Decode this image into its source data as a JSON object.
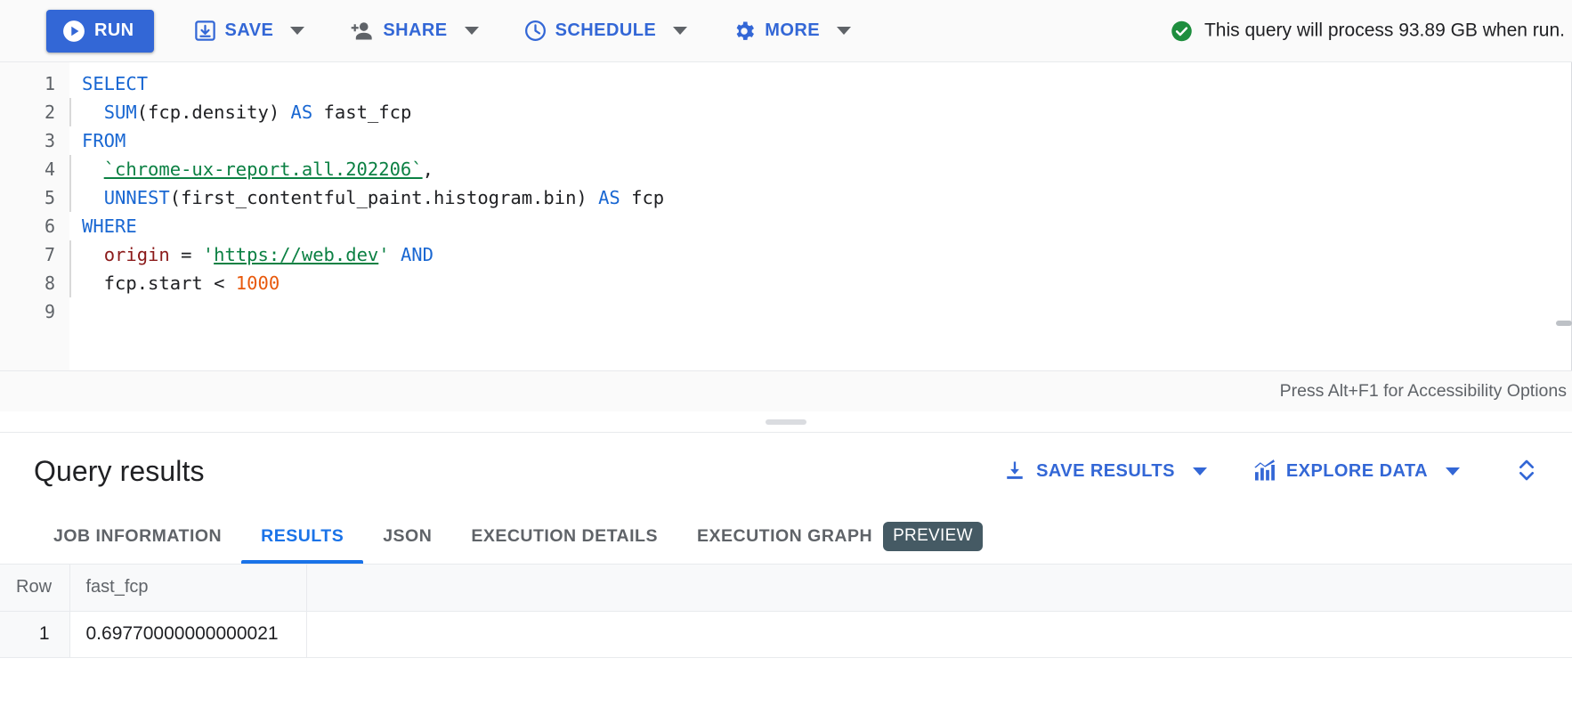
{
  "toolbar": {
    "run_label": "RUN",
    "save_label": "SAVE",
    "share_label": "SHARE",
    "schedule_label": "SCHEDULE",
    "more_label": "MORE",
    "cost_message": "This query will process 93.89 GB when run.",
    "icons": {
      "run": "play-circle-icon",
      "save": "save-download-icon",
      "share": "person-add-icon",
      "schedule": "clock-icon",
      "more": "gear-icon",
      "validation": "check-circle-icon"
    },
    "colors": {
      "accent_blue": "#3367d6",
      "success_green": "#1e8e3e",
      "caret_gray": "#5f6368"
    }
  },
  "editor": {
    "line_numbers": [
      "1",
      "2",
      "3",
      "4",
      "5",
      "6",
      "7",
      "8",
      "9"
    ],
    "lines": [
      {
        "n": "1",
        "tokens": [
          {
            "t": "SELECT",
            "c": "kw"
          }
        ]
      },
      {
        "n": "2",
        "tokens": [
          {
            "t": "  ",
            "c": "plain"
          },
          {
            "t": "SUM",
            "c": "fn"
          },
          {
            "t": "(fcp.density) ",
            "c": "plain"
          },
          {
            "t": "AS",
            "c": "kw"
          },
          {
            "t": " fast_fcp",
            "c": "plain"
          }
        ]
      },
      {
        "n": "3",
        "tokens": [
          {
            "t": "FROM",
            "c": "kw"
          }
        ]
      },
      {
        "n": "4",
        "tokens": [
          {
            "t": "  ",
            "c": "plain"
          },
          {
            "t": "`chrome-ux-report.all.202206`",
            "c": "str"
          },
          {
            "t": ",",
            "c": "plain"
          }
        ]
      },
      {
        "n": "5",
        "tokens": [
          {
            "t": "  ",
            "c": "plain"
          },
          {
            "t": "UNNEST",
            "c": "fn"
          },
          {
            "t": "(first_contentful_paint.histogram.bin) ",
            "c": "plain"
          },
          {
            "t": "AS",
            "c": "kw"
          },
          {
            "t": " fcp",
            "c": "plain"
          }
        ]
      },
      {
        "n": "6",
        "tokens": [
          {
            "t": "WHERE",
            "c": "kw"
          }
        ]
      },
      {
        "n": "7",
        "tokens": [
          {
            "t": "  ",
            "c": "plain"
          },
          {
            "t": "origin",
            "c": "fld"
          },
          {
            "t": " = ",
            "c": "plain"
          },
          {
            "t": "'",
            "c": "strq"
          },
          {
            "t": "https://web.dev",
            "c": "str"
          },
          {
            "t": "'",
            "c": "strq"
          },
          {
            "t": " ",
            "c": "plain"
          },
          {
            "t": "AND",
            "c": "kw"
          }
        ]
      },
      {
        "n": "8",
        "tokens": [
          {
            "t": "  fcp.start < ",
            "c": "plain"
          },
          {
            "t": "1000",
            "c": "num"
          }
        ]
      },
      {
        "n": "9",
        "tokens": [
          {
            "t": "",
            "c": "plain"
          }
        ]
      }
    ],
    "accessibility_hint": "Press Alt+F1 for Accessibility Options",
    "syntax_colors": {
      "keyword": "#1967d2",
      "string": "#0b8043",
      "number": "#e8590c",
      "field": "#8b1a1a",
      "plain": "#202124"
    }
  },
  "results": {
    "title": "Query results",
    "save_results_label": "SAVE RESULTS",
    "explore_data_label": "EXPLORE DATA",
    "icons": {
      "save_results": "download-icon",
      "explore_data": "bar-chart-icon",
      "expand": "unfold-more-icon"
    },
    "tabs": [
      {
        "label": "JOB INFORMATION",
        "active": false,
        "badge": null
      },
      {
        "label": "RESULTS",
        "active": true,
        "badge": null
      },
      {
        "label": "JSON",
        "active": false,
        "badge": null
      },
      {
        "label": "EXECUTION DETAILS",
        "active": false,
        "badge": null
      },
      {
        "label": "EXECUTION GRAPH",
        "active": false,
        "badge": "PREVIEW"
      }
    ],
    "table": {
      "columns": [
        "Row",
        "fast_fcp",
        ""
      ],
      "rows": [
        {
          "row": "1",
          "fast_fcp": "0.69770000000000021",
          "blank": ""
        }
      ]
    }
  }
}
